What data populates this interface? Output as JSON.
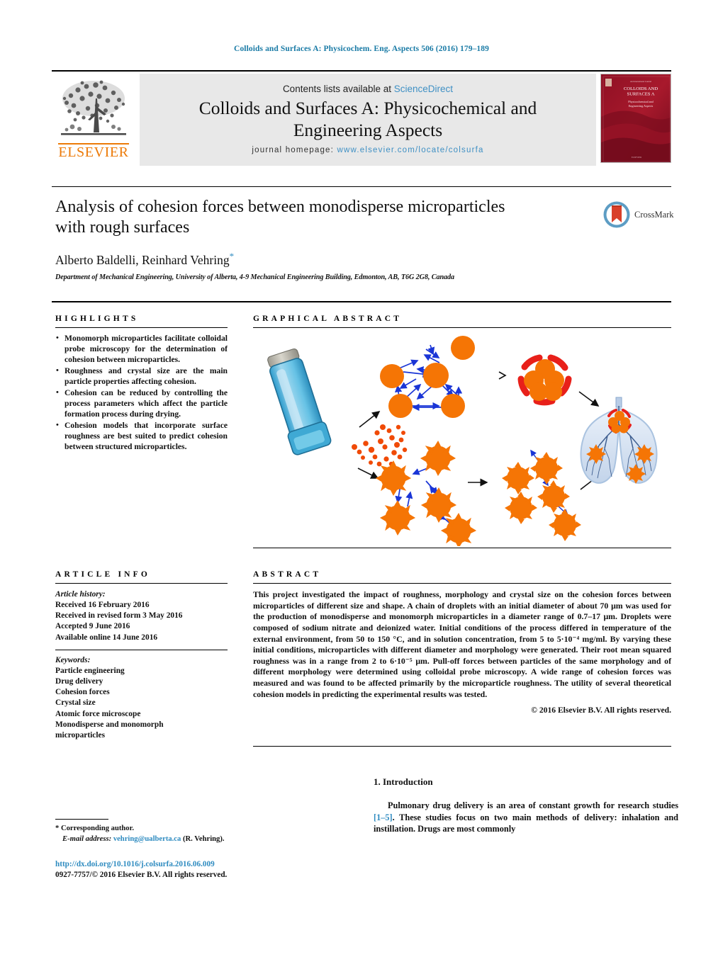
{
  "running_head": "Colloids and Surfaces A: Physicochem. Eng. Aspects 506 (2016) 179–189",
  "masthead": {
    "contents_prefix": "Contents lists available at ",
    "sciencedirect": "ScienceDirect",
    "journal_line1": "Colloids and Surfaces A: Physicochemical and",
    "journal_line2": "Engineering Aspects",
    "homepage_label": "journal homepage: ",
    "homepage_url": "www.elsevier.com/locate/colsurfa",
    "elsevier_wordmark": "ELSEVIER",
    "cover_title_line1": "COLLOIDS AND",
    "cover_title_line2": "SURFACES A",
    "cover_sub1": "Physicochemical and",
    "cover_sub2": "Engineering Aspects",
    "cover_top_label": "An International Journal"
  },
  "title": {
    "line1": "Analysis of cohesion forces between monodisperse microparticles",
    "line2": "with rough surfaces",
    "authors": "Alberto Baldelli, Reinhard Vehring",
    "corresponding_marker": "*",
    "affiliation": "Department of Mechanical Engineering, University of Alberta, 4-9 Mechanical Engineering Building, Edmonton, AB, T6G 2G8, Canada",
    "crossmark_label": "CrossMark"
  },
  "highlights": {
    "heading": "HIGHLIGHTS",
    "items": [
      "Monomorph microparticles facilitate colloidal probe microscopy for the determination of cohesion between microparticles.",
      "Roughness and crystal size are the main particle properties affecting cohesion.",
      "Cohesion can be reduced by controlling the process parameters which affect the particle formation process during drying.",
      "Cohesion models that incorporate surface roughness are best suited to predict cohesion between structured microparticles."
    ]
  },
  "graphical_abstract": {
    "heading": "GRAPHICAL ABSTRACT",
    "elements": [
      "inhaler-device",
      "aerosol-plume",
      "smooth-particle-network",
      "rough-particle-network",
      "agglomerate-with-red-arcs",
      "dispersed-rough-particles",
      "lungs-diagram"
    ],
    "colors": {
      "particle": "#f57505",
      "cohesion_arrow": "#1a35d6",
      "red_arc": "#e8201a",
      "inhaler_body": "#4cb6e0",
      "lung": "#c6d8ef"
    }
  },
  "article_info": {
    "heading": "ARTICLE INFO",
    "history_label": "Article history:",
    "history": [
      "Received 16 February 2016",
      "Received in revised form 3 May 2016",
      "Accepted 9 June 2016",
      "Available online 14 June 2016"
    ],
    "keywords_label": "Keywords:",
    "keywords": [
      "Particle engineering",
      "Drug delivery",
      "Cohesion forces",
      "Crystal size",
      "Atomic force microscope",
      "Monodisperse and monomorph",
      "microparticles"
    ]
  },
  "abstract": {
    "heading": "ABSTRACT",
    "body": "This project investigated the impact of roughness, morphology and crystal size on the cohesion forces between microparticles of different size and shape. A chain of droplets with an initial diameter of about 70 μm was used for the production of monodisperse and monomorph microparticles in a diameter range of 0.7–17 μm. Droplets were composed of sodium nitrate and deionized water. Initial conditions of the process differed in temperature of the external environment, from 50 to 150 °C, and in solution concentration, from 5 to 5·10⁻⁴ mg/ml. By varying these initial conditions, microparticles with different diameter and morphology were generated. Their root mean squared roughness was in a range from 2 to 6·10⁻⁵ μm. Pull-off forces between particles of the same morphology and of different morphology were determined using colloidal probe microscopy. A wide range of cohesion forces was measured and was found to be affected primarily by the microparticle roughness. The utility of several theoretical cohesion models in predicting the experimental results was tested.",
    "copyright": "© 2016 Elsevier B.V. All rights reserved."
  },
  "introduction": {
    "heading": "1. Introduction",
    "paragraph_part1": "Pulmonary drug delivery is an area of constant growth for research studies ",
    "citation": "[1–5]",
    "paragraph_part2": ". These studies focus on two main methods of delivery: inhalation and instillation. Drugs are most commonly"
  },
  "footnote": {
    "corresponding_author": "* Corresponding author.",
    "email_label": "E-mail address:",
    "email": "vehring@ualberta.ca",
    "email_suffix": "(R. Vehring)."
  },
  "footer": {
    "doi": "http://dx.doi.org/10.1016/j.colsurfa.2016.06.009",
    "issn": "0927-7757/© 2016 Elsevier B.V. All rights reserved."
  }
}
